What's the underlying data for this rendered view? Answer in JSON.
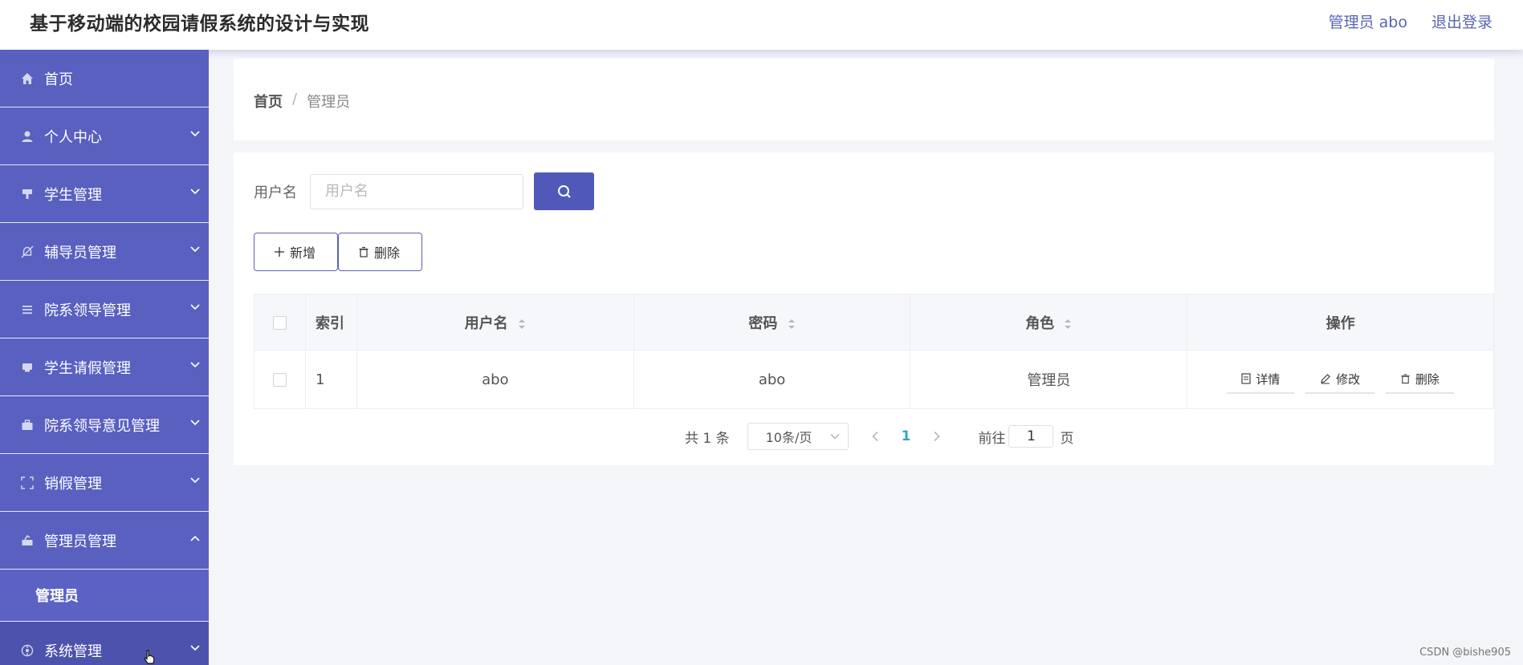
{
  "header": {
    "title": "基于移动端的校园请假系统的设计与实现",
    "user_label": "管理员 abo",
    "logout_label": "退出登录"
  },
  "sidebar": {
    "items": [
      {
        "label": "首页",
        "icon": "home-icon"
      },
      {
        "label": "个人中心",
        "icon": "user-icon"
      },
      {
        "label": "学生管理",
        "icon": "student-icon"
      },
      {
        "label": "辅导员管理",
        "icon": "bell-off-icon"
      },
      {
        "label": "院系领导管理",
        "icon": "list-icon"
      },
      {
        "label": "学生请假管理",
        "icon": "card-icon"
      },
      {
        "label": "院系领导意见管理",
        "icon": "briefcase-icon"
      },
      {
        "label": "销假管理",
        "icon": "scan-icon"
      },
      {
        "label": "管理员管理",
        "icon": "admin-icon"
      },
      {
        "label": "系统管理",
        "icon": "settings-icon"
      }
    ],
    "submenu": {
      "label": "管理员"
    }
  },
  "breadcrumb": {
    "home": "首页",
    "separator": "/",
    "current": "管理员"
  },
  "search": {
    "label": "用户名",
    "placeholder": "用户名",
    "value": ""
  },
  "actions": {
    "add_label": "新增",
    "delete_label": "删除"
  },
  "table": {
    "columns": {
      "index": "索引",
      "username": "用户名",
      "password": "密码",
      "role": "角色",
      "actions": "操作"
    },
    "rows": [
      {
        "index": "1",
        "username": "abo",
        "password": "abo",
        "role": "管理员"
      }
    ],
    "row_actions": {
      "detail": "详情",
      "edit": "修改",
      "delete": "删除"
    }
  },
  "pagination": {
    "total": "共 1 条",
    "page_size": "10条/页",
    "current_page": "1",
    "goto_label": "前往",
    "goto_value": "1",
    "page_suffix": "页"
  },
  "watermark": "CSDN @bishe905",
  "colors": {
    "sidebar": "#5c62c3",
    "accent": "#5059b8",
    "link": "#5a63b5",
    "active_page": "#3aa7b8"
  }
}
